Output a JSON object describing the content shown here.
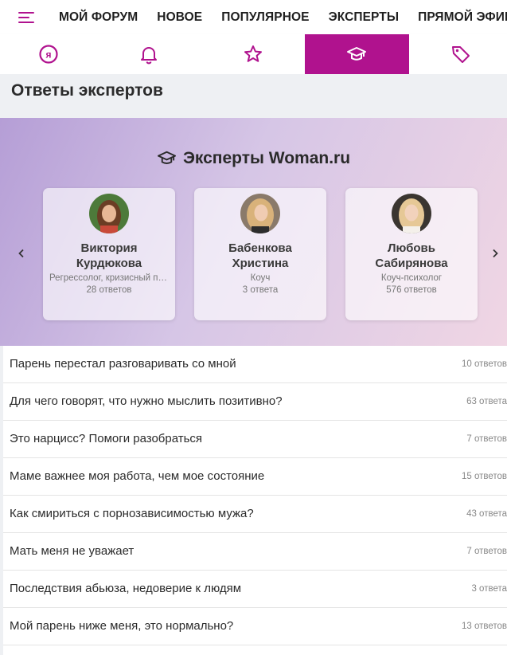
{
  "topnav": {
    "items": [
      "МОЙ ФОРУМ",
      "НОВОЕ",
      "ПОПУЛЯРНОЕ",
      "ЭКСПЕРТЫ",
      "ПРЯМОЙ ЭФИР"
    ]
  },
  "tabs": [
    {
      "icon": "ya-icon",
      "active": false
    },
    {
      "icon": "bell-icon",
      "active": false
    },
    {
      "icon": "star-icon",
      "active": false
    },
    {
      "icon": "graduation-cap-icon",
      "active": true
    },
    {
      "icon": "tag-icon",
      "active": false
    }
  ],
  "page": {
    "title": "Ответы экспертов"
  },
  "experts": {
    "title": "Эксперты Woman.ru",
    "cards": [
      {
        "name_line1": "Виктория",
        "name_line2": "Курдюкова",
        "role": "Регрессолог, кризисный психолог",
        "answers": "28 ответов"
      },
      {
        "name_line1": "Бабенкова",
        "name_line2": "Христина",
        "role": "Коуч",
        "answers": "3 ответа"
      },
      {
        "name_line1": "Любовь",
        "name_line2": "Сабирянова",
        "role": "Коуч-психолог",
        "answers": "576 ответов"
      }
    ]
  },
  "questions": [
    {
      "text": "Парень перестал разговаривать со мной",
      "count": "10 ответов"
    },
    {
      "text": "Для чего говорят, что нужно мыслить позитивно?",
      "count": "63 ответа"
    },
    {
      "text": "Это нарцисс? Помоги разобраться",
      "count": "7 ответов"
    },
    {
      "text": "Маме важнее моя работа, чем мое состояние",
      "count": "15 ответов"
    },
    {
      "text": "Как смириться с порнозависимостью мужа?",
      "count": "43 ответа"
    },
    {
      "text": "Мать меня не уважает",
      "count": "7 ответов"
    },
    {
      "text": "Последствия абьюза, недоверие к людям",
      "count": "3 ответа"
    },
    {
      "text": "Мой парень ниже меня, это нормально?",
      "count": "13 ответов"
    }
  ],
  "colors": {
    "accent": "#b0128e",
    "page_bg": "#eef0f3"
  }
}
